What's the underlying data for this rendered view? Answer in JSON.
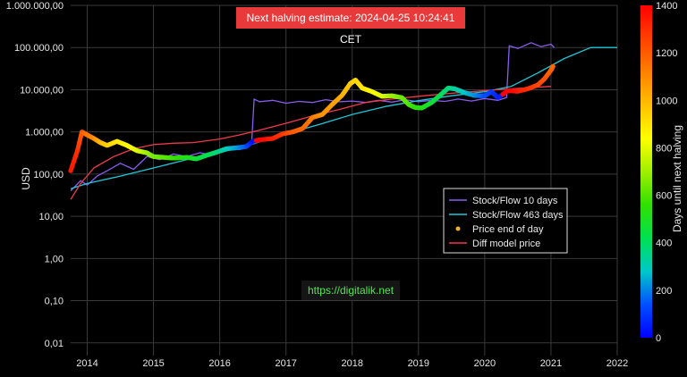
{
  "header": {
    "banner_text": "Next halving estimate: 2024-04-25 10:24:41 CET"
  },
  "watermark": {
    "text": "https://digitalik.net"
  },
  "colors": {
    "stock_flow_10": "#8a5cf0",
    "stock_flow_463": "#1ec8d8",
    "price_dot": "#f0b030",
    "diff_model": "#f03a4a",
    "banner_bg": "#e83a3a",
    "watermark_text": "#4fe84f"
  },
  "chart_data": {
    "type": "line",
    "xlabel": "",
    "ylabel": "USD",
    "yscale": "log",
    "xlim": [
      2013.75,
      2022.0
    ],
    "ylim": [
      0.005,
      1000000
    ],
    "x_ticks": [
      2014,
      2015,
      2016,
      2017,
      2018,
      2019,
      2020,
      2021,
      2022
    ],
    "x_tick_labels": [
      "2014",
      "2015",
      "2016",
      "2017",
      "2018",
      "2019",
      "2020",
      "2021",
      "2022"
    ],
    "y_ticks": [
      0.01,
      0.1,
      1,
      10,
      100,
      1000,
      10000,
      100000,
      1000000
    ],
    "y_tick_labels": [
      "0,01",
      "0,10",
      "1,00",
      "10,00",
      "100,00",
      "1.000,00",
      "10.000,00",
      "100.000,00",
      "1.000.000,00"
    ],
    "grid": true,
    "legend_position": "right-center",
    "legend": [
      "Stock/Flow 10 days",
      "Stock/Flow 463 days",
      "Price end of day",
      "Diff model price"
    ],
    "colorbar": {
      "label": "Days until next halving",
      "min": 0,
      "max": 1400,
      "ticks": [
        0,
        200,
        400,
        600,
        800,
        1000,
        1200,
        1400
      ],
      "tick_labels": [
        "0",
        "200",
        "400",
        "600",
        "800",
        "1000",
        "1200",
        "1400"
      ],
      "colorscale": [
        "#0000ff",
        "#0050ff",
        "#00c8c8",
        "#00e050",
        "#30e000",
        "#a0f000",
        "#ffff00",
        "#ffc000",
        "#ff8000",
        "#ff4000",
        "#ff0000"
      ]
    },
    "series": [
      {
        "name": "Stock/Flow 10 days",
        "x": [
          2013.75,
          2013.9,
          2014.0,
          2014.15,
          2014.3,
          2014.5,
          2014.7,
          2014.9,
          2015.1,
          2015.3,
          2015.5,
          2015.7,
          2015.9,
          2016.1,
          2016.3,
          2016.48,
          2016.52,
          2016.6,
          2016.8,
          2017.0,
          2017.2,
          2017.4,
          2017.6,
          2017.8,
          2018.0,
          2018.2,
          2018.4,
          2018.6,
          2018.8,
          2019.0,
          2019.2,
          2019.4,
          2019.6,
          2019.8,
          2020.0,
          2020.2,
          2020.33,
          2020.37,
          2020.5,
          2020.7,
          2020.85,
          2021.0,
          2021.05
        ],
        "y": [
          40,
          70,
          55,
          90,
          120,
          180,
          130,
          260,
          220,
          300,
          260,
          320,
          280,
          420,
          380,
          500,
          6000,
          5200,
          5600,
          4800,
          5300,
          5000,
          5800,
          5200,
          5400,
          5000,
          5600,
          5100,
          5800,
          5200,
          5600,
          5300,
          6000,
          5400,
          6200,
          5600,
          6500,
          110000,
          95000,
          130000,
          105000,
          120000,
          100000
        ]
      },
      {
        "name": "Stock/Flow 463 days",
        "x": [
          2013.75,
          2014.0,
          2014.5,
          2015.0,
          2015.5,
          2016.0,
          2016.5,
          2017.0,
          2017.5,
          2018.0,
          2018.5,
          2019.0,
          2019.5,
          2020.0,
          2020.4,
          2020.8,
          2021.2,
          2021.6,
          2022.0
        ],
        "y": [
          45,
          60,
          90,
          140,
          220,
          320,
          520,
          900,
          1500,
          2600,
          4000,
          5500,
          7200,
          9000,
          12000,
          25000,
          55000,
          100000,
          100000
        ]
      },
      {
        "name": "Diff model price",
        "x": [
          2013.75,
          2013.9,
          2014.1,
          2014.4,
          2014.7,
          2015.0,
          2015.3,
          2015.6,
          2016.0,
          2016.3,
          2016.6,
          2017.0,
          2017.4,
          2017.8,
          2018.2,
          2018.6,
          2019.0,
          2019.4,
          2019.8,
          2020.2,
          2020.6,
          2021.0
        ],
        "y": [
          25,
          60,
          140,
          260,
          400,
          500,
          540,
          560,
          680,
          850,
          1100,
          1600,
          2400,
          3400,
          5000,
          6000,
          7000,
          8000,
          9000,
          10000,
          11000,
          12000
        ]
      },
      {
        "name": "Price end of day",
        "x": [
          2013.75,
          2013.85,
          2013.92,
          2014.0,
          2014.1,
          2014.2,
          2014.3,
          2014.45,
          2014.6,
          2014.75,
          2014.9,
          2015.0,
          2015.15,
          2015.3,
          2015.5,
          2015.65,
          2015.8,
          2015.95,
          2016.1,
          2016.25,
          2016.4,
          2016.5,
          2016.6,
          2016.8,
          2016.95,
          2017.1,
          2017.25,
          2017.4,
          2017.55,
          2017.7,
          2017.85,
          2017.97,
          2018.05,
          2018.15,
          2018.3,
          2018.45,
          2018.6,
          2018.75,
          2018.85,
          2018.95,
          2019.05,
          2019.2,
          2019.35,
          2019.45,
          2019.55,
          2019.7,
          2019.85,
          2020.0,
          2020.1,
          2020.2,
          2020.35,
          2020.5,
          2020.65,
          2020.8,
          2020.9,
          2021.0,
          2021.03
        ],
        "y": [
          120,
          350,
          1000,
          850,
          700,
          560,
          480,
          600,
          480,
          360,
          320,
          260,
          250,
          240,
          250,
          230,
          280,
          330,
          400,
          420,
          450,
          600,
          650,
          700,
          900,
          1000,
          1200,
          2200,
          2600,
          4500,
          7500,
          14000,
          17000,
          11000,
          9000,
          7000,
          7200,
          6500,
          4500,
          3800,
          3700,
          5000,
          8000,
          11000,
          10500,
          8500,
          7300,
          7200,
          9000,
          6500,
          9500,
          9200,
          10500,
          13000,
          18000,
          29000,
          36000
        ],
        "days_until_halving": [
          1350,
          1300,
          1200,
          1150,
          1100,
          1000,
          950,
          900,
          850,
          800,
          700,
          650,
          620,
          580,
          520,
          470,
          420,
          380,
          300,
          240,
          150,
          30,
          1400,
          1330,
          1280,
          1200,
          1180,
          1130,
          1080,
          1060,
          1020,
          960,
          930,
          900,
          850,
          800,
          700,
          640,
          610,
          560,
          520,
          470,
          410,
          370,
          330,
          280,
          220,
          140,
          110,
          60,
          1400,
          1350,
          1300,
          1250,
          1220,
          1190,
          1180
        ]
      }
    ]
  }
}
